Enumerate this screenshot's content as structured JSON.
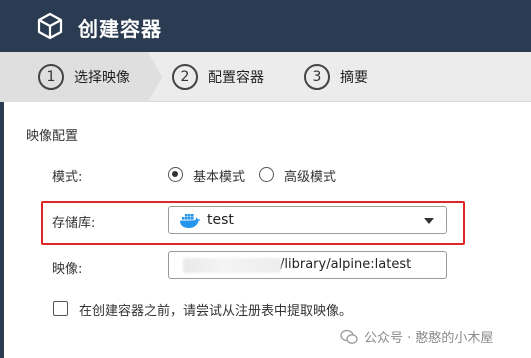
{
  "header": {
    "title": "创建容器",
    "icon": "cube-icon"
  },
  "steps": [
    {
      "num": "1",
      "label": "选择映像",
      "active": true
    },
    {
      "num": "2",
      "label": "配置容器",
      "active": false
    },
    {
      "num": "3",
      "label": "摘要",
      "active": false
    }
  ],
  "section": {
    "title": "映像配置"
  },
  "mode": {
    "label": "模式:",
    "options": [
      {
        "label": "基本模式",
        "checked": true
      },
      {
        "label": "高级模式",
        "checked": false
      }
    ]
  },
  "repository": {
    "label": "存储库:",
    "value": "test",
    "icon": "docker-icon"
  },
  "image": {
    "label": "映像:",
    "value_suffix": "/library/alpine:latest"
  },
  "pull_option": {
    "label": "在创建容器之前，请尝试从注册表中提取映像。",
    "checked": false
  },
  "watermark": {
    "text": "公众号 · 憨憨的小木屋"
  },
  "colors": {
    "header_bg": "#2b3c52",
    "highlight": "#e02525",
    "docker_blue": "#2496ed"
  }
}
